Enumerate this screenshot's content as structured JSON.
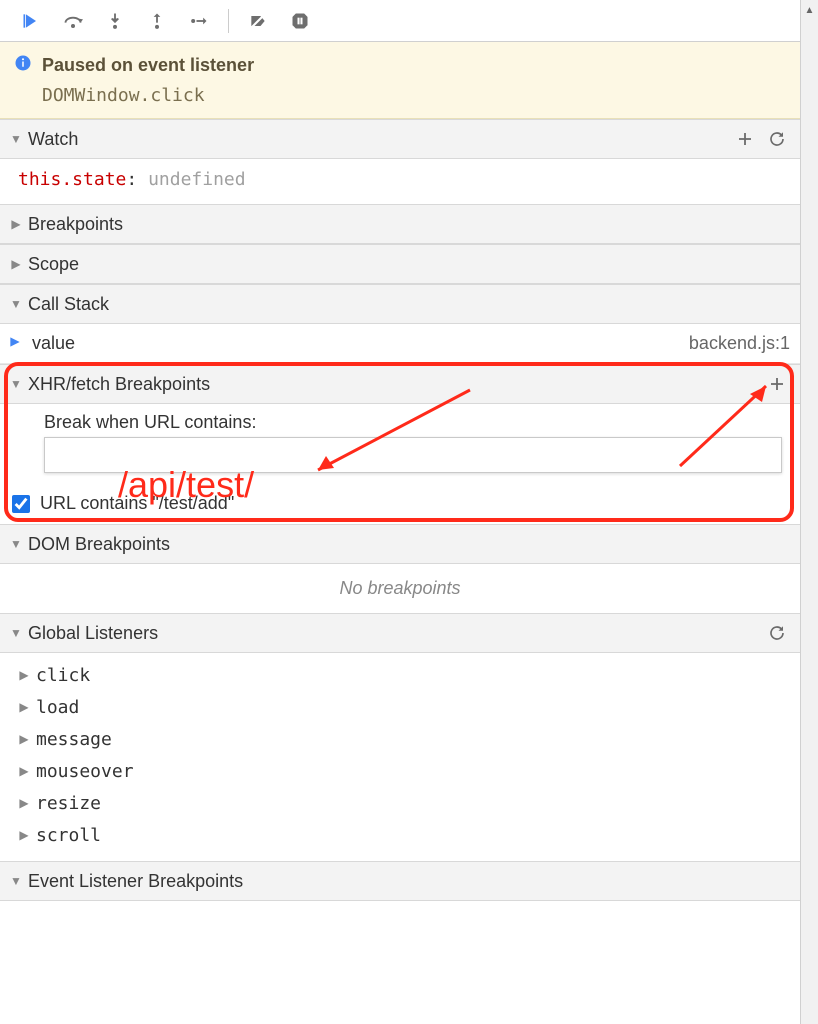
{
  "toolbar": {
    "resume": "resume",
    "step_over": "step-over",
    "step_into": "step-into",
    "step_out": "step-out",
    "step": "step",
    "deactivate": "deactivate-breakpoints",
    "pause_exceptions": "pause-on-exceptions"
  },
  "paused": {
    "title": "Paused on event listener",
    "subtitle": "DOMWindow.click"
  },
  "watch": {
    "title": "Watch",
    "expr": "this.state",
    "value": "undefined"
  },
  "sections": {
    "breakpoints": "Breakpoints",
    "scope": "Scope",
    "callstack": "Call Stack",
    "xhr": "XHR/fetch Breakpoints",
    "dom": "DOM Breakpoints",
    "global": "Global Listeners",
    "elb": "Event Listener Breakpoints"
  },
  "callstack": {
    "frame_name": "value",
    "frame_loc": "backend.js:1"
  },
  "xhr": {
    "input_label": "Break when URL contains:",
    "input_value": "",
    "item_label": "URL contains \"/test/add\"",
    "item_checked": true
  },
  "annotation": {
    "text": "/api/test/"
  },
  "dom": {
    "empty": "No breakpoints"
  },
  "global_listeners": [
    "click",
    "load",
    "message",
    "mouseover",
    "resize",
    "scroll"
  ]
}
